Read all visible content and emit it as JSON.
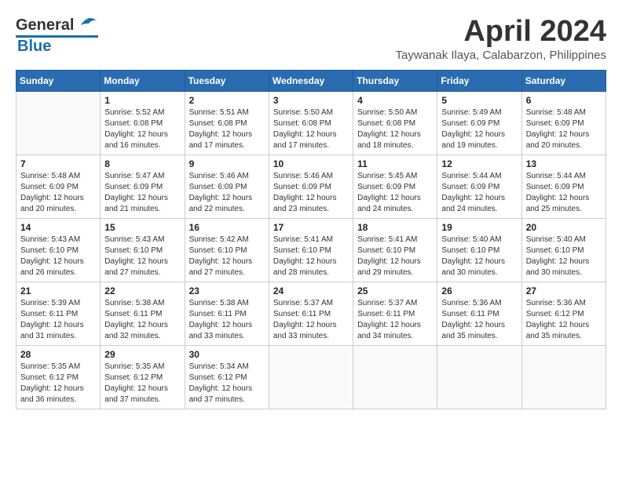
{
  "header": {
    "logo": {
      "line1": "General",
      "line2": "Blue"
    },
    "title": "April 2024",
    "location": "Taywanak Ilaya, Calabarzon, Philippines"
  },
  "weekdays": [
    "Sunday",
    "Monday",
    "Tuesday",
    "Wednesday",
    "Thursday",
    "Friday",
    "Saturday"
  ],
  "weeks": [
    [
      {
        "day": "",
        "sunrise": "",
        "sunset": "",
        "daylight": ""
      },
      {
        "day": "1",
        "sunrise": "Sunrise: 5:52 AM",
        "sunset": "Sunset: 6:08 PM",
        "daylight": "Daylight: 12 hours and 16 minutes."
      },
      {
        "day": "2",
        "sunrise": "Sunrise: 5:51 AM",
        "sunset": "Sunset: 6:08 PM",
        "daylight": "Daylight: 12 hours and 17 minutes."
      },
      {
        "day": "3",
        "sunrise": "Sunrise: 5:50 AM",
        "sunset": "Sunset: 6:08 PM",
        "daylight": "Daylight: 12 hours and 17 minutes."
      },
      {
        "day": "4",
        "sunrise": "Sunrise: 5:50 AM",
        "sunset": "Sunset: 6:08 PM",
        "daylight": "Daylight: 12 hours and 18 minutes."
      },
      {
        "day": "5",
        "sunrise": "Sunrise: 5:49 AM",
        "sunset": "Sunset: 6:09 PM",
        "daylight": "Daylight: 12 hours and 19 minutes."
      },
      {
        "day": "6",
        "sunrise": "Sunrise: 5:48 AM",
        "sunset": "Sunset: 6:09 PM",
        "daylight": "Daylight: 12 hours and 20 minutes."
      }
    ],
    [
      {
        "day": "7",
        "sunrise": "Sunrise: 5:48 AM",
        "sunset": "Sunset: 6:09 PM",
        "daylight": "Daylight: 12 hours and 20 minutes."
      },
      {
        "day": "8",
        "sunrise": "Sunrise: 5:47 AM",
        "sunset": "Sunset: 6:09 PM",
        "daylight": "Daylight: 12 hours and 21 minutes."
      },
      {
        "day": "9",
        "sunrise": "Sunrise: 5:46 AM",
        "sunset": "Sunset: 6:09 PM",
        "daylight": "Daylight: 12 hours and 22 minutes."
      },
      {
        "day": "10",
        "sunrise": "Sunrise: 5:46 AM",
        "sunset": "Sunset: 6:09 PM",
        "daylight": "Daylight: 12 hours and 23 minutes."
      },
      {
        "day": "11",
        "sunrise": "Sunrise: 5:45 AM",
        "sunset": "Sunset: 6:09 PM",
        "daylight": "Daylight: 12 hours and 24 minutes."
      },
      {
        "day": "12",
        "sunrise": "Sunrise: 5:44 AM",
        "sunset": "Sunset: 6:09 PM",
        "daylight": "Daylight: 12 hours and 24 minutes."
      },
      {
        "day": "13",
        "sunrise": "Sunrise: 5:44 AM",
        "sunset": "Sunset: 6:09 PM",
        "daylight": "Daylight: 12 hours and 25 minutes."
      }
    ],
    [
      {
        "day": "14",
        "sunrise": "Sunrise: 5:43 AM",
        "sunset": "Sunset: 6:10 PM",
        "daylight": "Daylight: 12 hours and 26 minutes."
      },
      {
        "day": "15",
        "sunrise": "Sunrise: 5:43 AM",
        "sunset": "Sunset: 6:10 PM",
        "daylight": "Daylight: 12 hours and 27 minutes."
      },
      {
        "day": "16",
        "sunrise": "Sunrise: 5:42 AM",
        "sunset": "Sunset: 6:10 PM",
        "daylight": "Daylight: 12 hours and 27 minutes."
      },
      {
        "day": "17",
        "sunrise": "Sunrise: 5:41 AM",
        "sunset": "Sunset: 6:10 PM",
        "daylight": "Daylight: 12 hours and 28 minutes."
      },
      {
        "day": "18",
        "sunrise": "Sunrise: 5:41 AM",
        "sunset": "Sunset: 6:10 PM",
        "daylight": "Daylight: 12 hours and 29 minutes."
      },
      {
        "day": "19",
        "sunrise": "Sunrise: 5:40 AM",
        "sunset": "Sunset: 6:10 PM",
        "daylight": "Daylight: 12 hours and 30 minutes."
      },
      {
        "day": "20",
        "sunrise": "Sunrise: 5:40 AM",
        "sunset": "Sunset: 6:10 PM",
        "daylight": "Daylight: 12 hours and 30 minutes."
      }
    ],
    [
      {
        "day": "21",
        "sunrise": "Sunrise: 5:39 AM",
        "sunset": "Sunset: 6:11 PM",
        "daylight": "Daylight: 12 hours and 31 minutes."
      },
      {
        "day": "22",
        "sunrise": "Sunrise: 5:38 AM",
        "sunset": "Sunset: 6:11 PM",
        "daylight": "Daylight: 12 hours and 32 minutes."
      },
      {
        "day": "23",
        "sunrise": "Sunrise: 5:38 AM",
        "sunset": "Sunset: 6:11 PM",
        "daylight": "Daylight: 12 hours and 33 minutes."
      },
      {
        "day": "24",
        "sunrise": "Sunrise: 5:37 AM",
        "sunset": "Sunset: 6:11 PM",
        "daylight": "Daylight: 12 hours and 33 minutes."
      },
      {
        "day": "25",
        "sunrise": "Sunrise: 5:37 AM",
        "sunset": "Sunset: 6:11 PM",
        "daylight": "Daylight: 12 hours and 34 minutes."
      },
      {
        "day": "26",
        "sunrise": "Sunrise: 5:36 AM",
        "sunset": "Sunset: 6:11 PM",
        "daylight": "Daylight: 12 hours and 35 minutes."
      },
      {
        "day": "27",
        "sunrise": "Sunrise: 5:36 AM",
        "sunset": "Sunset: 6:12 PM",
        "daylight": "Daylight: 12 hours and 35 minutes."
      }
    ],
    [
      {
        "day": "28",
        "sunrise": "Sunrise: 5:35 AM",
        "sunset": "Sunset: 6:12 PM",
        "daylight": "Daylight: 12 hours and 36 minutes."
      },
      {
        "day": "29",
        "sunrise": "Sunrise: 5:35 AM",
        "sunset": "Sunset: 6:12 PM",
        "daylight": "Daylight: 12 hours and 37 minutes."
      },
      {
        "day": "30",
        "sunrise": "Sunrise: 5:34 AM",
        "sunset": "Sunset: 6:12 PM",
        "daylight": "Daylight: 12 hours and 37 minutes."
      },
      {
        "day": "",
        "sunrise": "",
        "sunset": "",
        "daylight": ""
      },
      {
        "day": "",
        "sunrise": "",
        "sunset": "",
        "daylight": ""
      },
      {
        "day": "",
        "sunrise": "",
        "sunset": "",
        "daylight": ""
      },
      {
        "day": "",
        "sunrise": "",
        "sunset": "",
        "daylight": ""
      }
    ]
  ]
}
